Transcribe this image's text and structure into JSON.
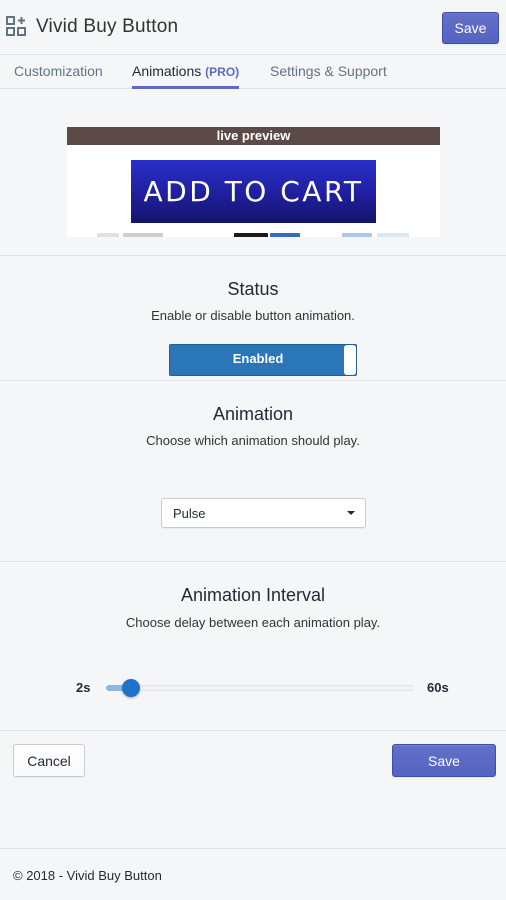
{
  "header": {
    "title": "Vivid Buy Button",
    "save_label": "Save"
  },
  "tabs": [
    {
      "label": "Customization",
      "active": false
    },
    {
      "label": "Animations",
      "badge": "(PRO)",
      "active": true
    },
    {
      "label": "Settings & Support",
      "active": false
    }
  ],
  "preview": {
    "bar_label": "live preview",
    "button_label": "ADD TO CART"
  },
  "status": {
    "title": "Status",
    "description": "Enable or disable button animation.",
    "toggle_label": "Enabled",
    "enabled": true
  },
  "animation": {
    "title": "Animation",
    "description": "Choose which animation should play.",
    "selected": "Pulse"
  },
  "interval": {
    "title": "Animation Interval",
    "description": "Choose delay between each animation play.",
    "min_label": "2s",
    "max_label": "60s",
    "value_fraction": 0.08
  },
  "actions": {
    "cancel_label": "Cancel",
    "save_label": "Save"
  },
  "footer": {
    "copyright": "© 2018 - Vivid Buy Button"
  },
  "colors": {
    "accent": "#5c6ac4",
    "toggle": "#2a76b6",
    "slider": "#1e73c7",
    "preview_bar": "#5b4a47",
    "cart_button": "#1f1f9e"
  }
}
